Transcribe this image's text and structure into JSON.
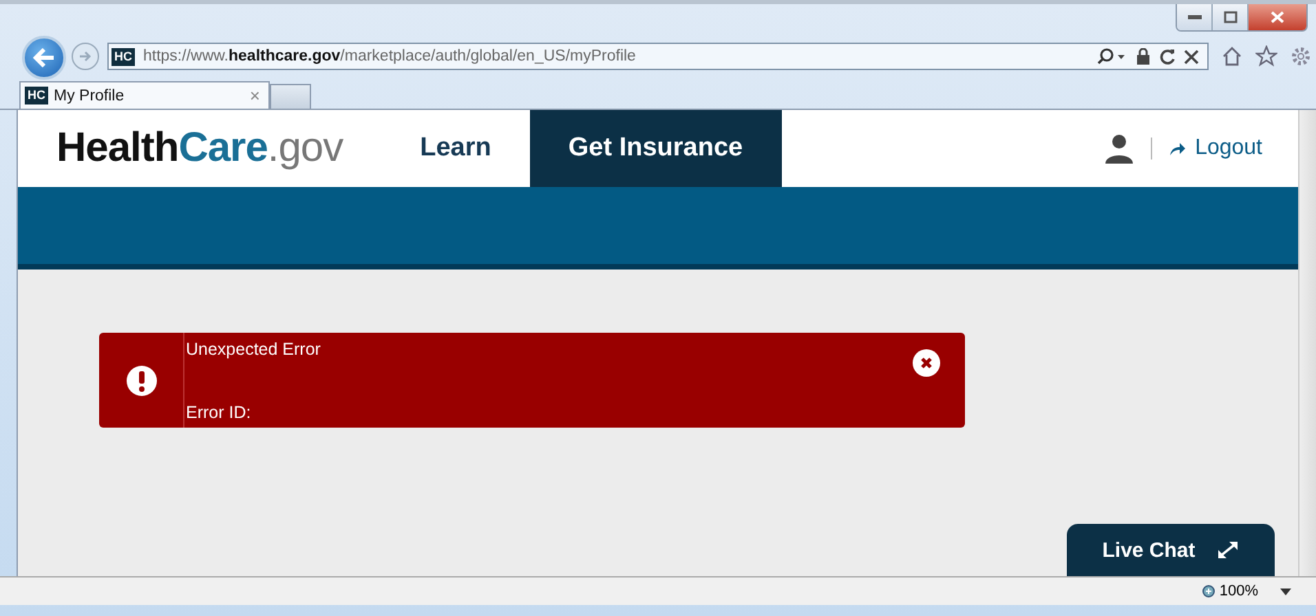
{
  "browser": {
    "url": "https://www.**healthcare.gov**/marketplace/auth/global/en_US/myProfile",
    "favicon": "HC",
    "tabs": [
      {
        "label": "My Profile",
        "favicon": "HC",
        "selected": true
      }
    ],
    "tab_close": "×",
    "zoom": "100%"
  },
  "site": {
    "logo": [
      {
        "text": "Health",
        "kind": "dark"
      },
      {
        "text": "Care",
        "kind": "teal"
      },
      {
        "text": ".gov",
        "kind": "light"
      }
    ],
    "nav": [
      {
        "label": "Learn",
        "selected": false
      },
      {
        "label": "Get Insurance",
        "selected": true
      }
    ],
    "logout": "Logout"
  },
  "error": {
    "title": "Unexpected Error",
    "error_id": "Error ID:"
  },
  "live_chat": "Live Chat"
}
